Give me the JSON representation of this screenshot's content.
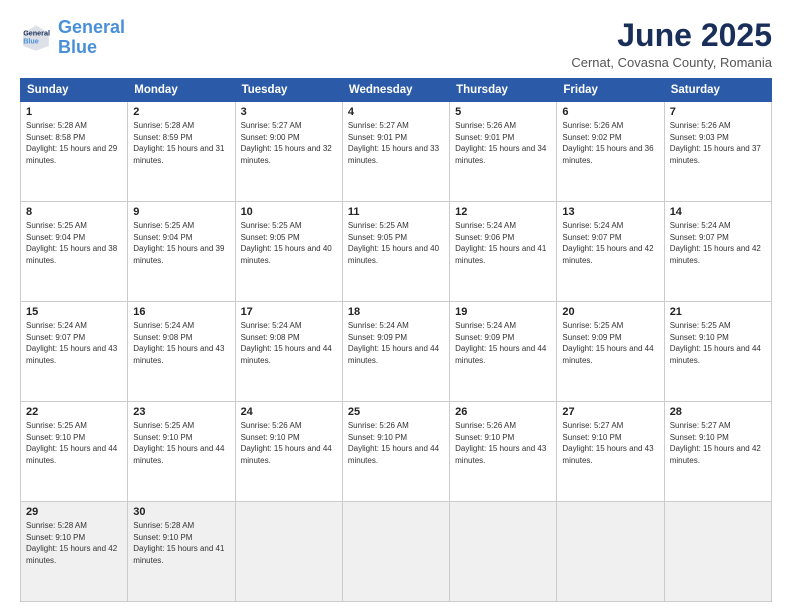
{
  "logo": {
    "line1": "General",
    "line2": "Blue"
  },
  "title": "June 2025",
  "subtitle": "Cernat, Covasna County, Romania",
  "weekdays": [
    "Sunday",
    "Monday",
    "Tuesday",
    "Wednesday",
    "Thursday",
    "Friday",
    "Saturday"
  ],
  "weeks": [
    [
      {
        "day": 1,
        "sunrise": "5:28 AM",
        "sunset": "8:58 PM",
        "daylight": "15 hours and 29 minutes."
      },
      {
        "day": 2,
        "sunrise": "5:28 AM",
        "sunset": "8:59 PM",
        "daylight": "15 hours and 31 minutes."
      },
      {
        "day": 3,
        "sunrise": "5:27 AM",
        "sunset": "9:00 PM",
        "daylight": "15 hours and 32 minutes."
      },
      {
        "day": 4,
        "sunrise": "5:27 AM",
        "sunset": "9:01 PM",
        "daylight": "15 hours and 33 minutes."
      },
      {
        "day": 5,
        "sunrise": "5:26 AM",
        "sunset": "9:01 PM",
        "daylight": "15 hours and 34 minutes."
      },
      {
        "day": 6,
        "sunrise": "5:26 AM",
        "sunset": "9:02 PM",
        "daylight": "15 hours and 36 minutes."
      },
      {
        "day": 7,
        "sunrise": "5:26 AM",
        "sunset": "9:03 PM",
        "daylight": "15 hours and 37 minutes."
      }
    ],
    [
      {
        "day": 8,
        "sunrise": "5:25 AM",
        "sunset": "9:04 PM",
        "daylight": "15 hours and 38 minutes."
      },
      {
        "day": 9,
        "sunrise": "5:25 AM",
        "sunset": "9:04 PM",
        "daylight": "15 hours and 39 minutes."
      },
      {
        "day": 10,
        "sunrise": "5:25 AM",
        "sunset": "9:05 PM",
        "daylight": "15 hours and 40 minutes."
      },
      {
        "day": 11,
        "sunrise": "5:25 AM",
        "sunset": "9:05 PM",
        "daylight": "15 hours and 40 minutes."
      },
      {
        "day": 12,
        "sunrise": "5:24 AM",
        "sunset": "9:06 PM",
        "daylight": "15 hours and 41 minutes."
      },
      {
        "day": 13,
        "sunrise": "5:24 AM",
        "sunset": "9:07 PM",
        "daylight": "15 hours and 42 minutes."
      },
      {
        "day": 14,
        "sunrise": "5:24 AM",
        "sunset": "9:07 PM",
        "daylight": "15 hours and 42 minutes."
      }
    ],
    [
      {
        "day": 15,
        "sunrise": "5:24 AM",
        "sunset": "9:07 PM",
        "daylight": "15 hours and 43 minutes."
      },
      {
        "day": 16,
        "sunrise": "5:24 AM",
        "sunset": "9:08 PM",
        "daylight": "15 hours and 43 minutes."
      },
      {
        "day": 17,
        "sunrise": "5:24 AM",
        "sunset": "9:08 PM",
        "daylight": "15 hours and 44 minutes."
      },
      {
        "day": 18,
        "sunrise": "5:24 AM",
        "sunset": "9:09 PM",
        "daylight": "15 hours and 44 minutes."
      },
      {
        "day": 19,
        "sunrise": "5:24 AM",
        "sunset": "9:09 PM",
        "daylight": "15 hours and 44 minutes."
      },
      {
        "day": 20,
        "sunrise": "5:25 AM",
        "sunset": "9:09 PM",
        "daylight": "15 hours and 44 minutes."
      },
      {
        "day": 21,
        "sunrise": "5:25 AM",
        "sunset": "9:10 PM",
        "daylight": "15 hours and 44 minutes."
      }
    ],
    [
      {
        "day": 22,
        "sunrise": "5:25 AM",
        "sunset": "9:10 PM",
        "daylight": "15 hours and 44 minutes."
      },
      {
        "day": 23,
        "sunrise": "5:25 AM",
        "sunset": "9:10 PM",
        "daylight": "15 hours and 44 minutes."
      },
      {
        "day": 24,
        "sunrise": "5:26 AM",
        "sunset": "9:10 PM",
        "daylight": "15 hours and 44 minutes."
      },
      {
        "day": 25,
        "sunrise": "5:26 AM",
        "sunset": "9:10 PM",
        "daylight": "15 hours and 44 minutes."
      },
      {
        "day": 26,
        "sunrise": "5:26 AM",
        "sunset": "9:10 PM",
        "daylight": "15 hours and 43 minutes."
      },
      {
        "day": 27,
        "sunrise": "5:27 AM",
        "sunset": "9:10 PM",
        "daylight": "15 hours and 43 minutes."
      },
      {
        "day": 28,
        "sunrise": "5:27 AM",
        "sunset": "9:10 PM",
        "daylight": "15 hours and 42 minutes."
      }
    ],
    [
      {
        "day": 29,
        "sunrise": "5:28 AM",
        "sunset": "9:10 PM",
        "daylight": "15 hours and 42 minutes."
      },
      {
        "day": 30,
        "sunrise": "5:28 AM",
        "sunset": "9:10 PM",
        "daylight": "15 hours and 41 minutes."
      },
      null,
      null,
      null,
      null,
      null
    ]
  ]
}
